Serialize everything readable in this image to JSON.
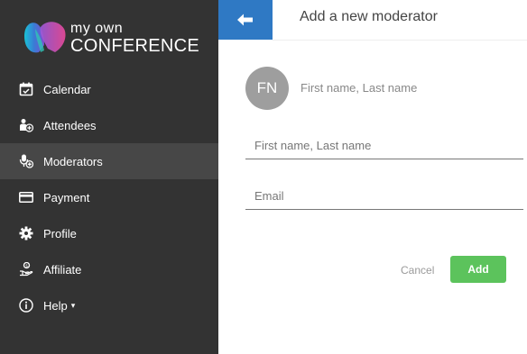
{
  "brand": {
    "line1": "my own",
    "line2": "CONFERENCE"
  },
  "sidebar": {
    "items": [
      {
        "label": "Calendar",
        "icon": "calendar-icon"
      },
      {
        "label": "Attendees",
        "icon": "attendees-icon"
      },
      {
        "label": "Moderators",
        "icon": "moderator-icon",
        "active": true
      },
      {
        "label": "Payment",
        "icon": "credit-card-icon"
      },
      {
        "label": "Profile",
        "icon": "gear-icon"
      },
      {
        "label": "Affiliate",
        "icon": "affiliate-hand-icon"
      },
      {
        "label": "Help",
        "icon": "info-icon",
        "caret": "▾"
      }
    ]
  },
  "header": {
    "title": "Add a new moderator",
    "back_icon": "arrow-left-icon"
  },
  "preview": {
    "initials": "FN",
    "name": "First name, Last name"
  },
  "form": {
    "name_placeholder": "First name, Last name",
    "email_placeholder": "Email"
  },
  "actions": {
    "cancel_label": "Cancel",
    "add_label": "Add"
  },
  "colors": {
    "sidebar": "#333333",
    "active": "#474747",
    "accent_blue": "#2f79c4",
    "add_green": "#5cc35c"
  }
}
